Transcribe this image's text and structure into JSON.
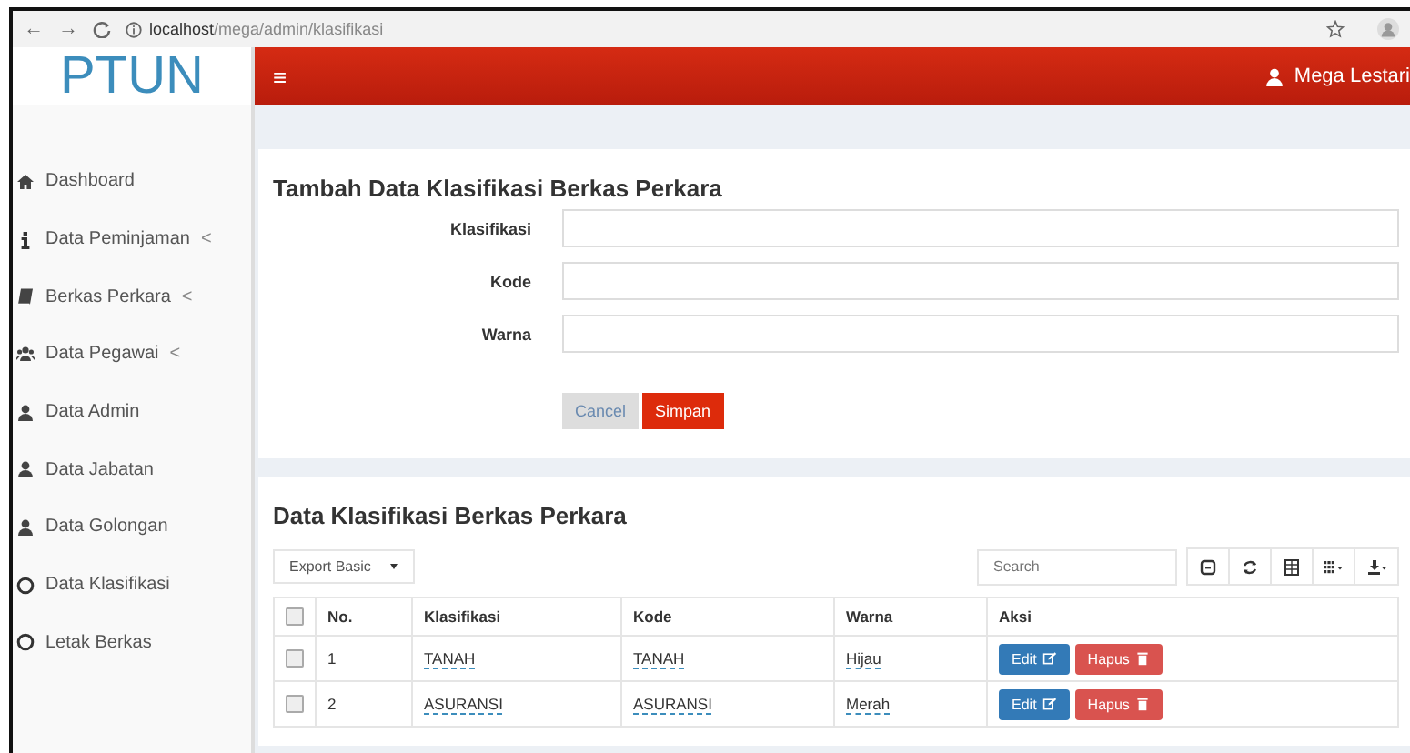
{
  "browser": {
    "back": "←",
    "forward": "→",
    "url_host": "localhost",
    "url_path": "/mega/admin/klasifikasi"
  },
  "brand": "PTUN",
  "header": {
    "menu_icon": "≡",
    "user": "Mega Lestari"
  },
  "sidebar": {
    "items": [
      {
        "label": "Dashboard"
      },
      {
        "label": "Data Peminjaman",
        "caret": "<"
      },
      {
        "label": "Berkas Perkara",
        "caret": "<"
      },
      {
        "label": "Data Pegawai",
        "caret": "<"
      },
      {
        "label": "Data Admin"
      },
      {
        "label": "Data Jabatan"
      },
      {
        "label": "Data Golongan"
      },
      {
        "label": "Data Klasifikasi"
      },
      {
        "label": "Letak Berkas"
      }
    ]
  },
  "form": {
    "title": "Tambah Data Klasifikasi Berkas Perkara",
    "fields": [
      {
        "label": "Klasifikasi"
      },
      {
        "label": "Kode"
      },
      {
        "label": "Warna"
      }
    ],
    "buttons": [
      {
        "label": "Cancel",
        "kind": "default"
      },
      {
        "label": "Simpan",
        "kind": "primary"
      }
    ]
  },
  "table_panel": {
    "title": "Data Klasifikasi Berkas Perkara",
    "export": "Export Basic",
    "search": {
      "placeholder": "Search"
    },
    "select_all": {
      "checked": false
    },
    "columns": [
      "No.",
      "Klasifikasi",
      "Kode",
      "Warna",
      "Aksi"
    ],
    "rows": [
      {
        "checked": false,
        "no": "1",
        "klasifikasi": "TANAH",
        "kode": "TANAH",
        "warna": "Hijau",
        "edit": "Edit",
        "delete": "Hapus"
      },
      {
        "checked": false,
        "no": "2",
        "klasifikasi": "ASURANSI",
        "kode": "ASURANSI",
        "warna": "Merah",
        "edit": "Edit",
        "delete": "Hapus"
      }
    ]
  }
}
